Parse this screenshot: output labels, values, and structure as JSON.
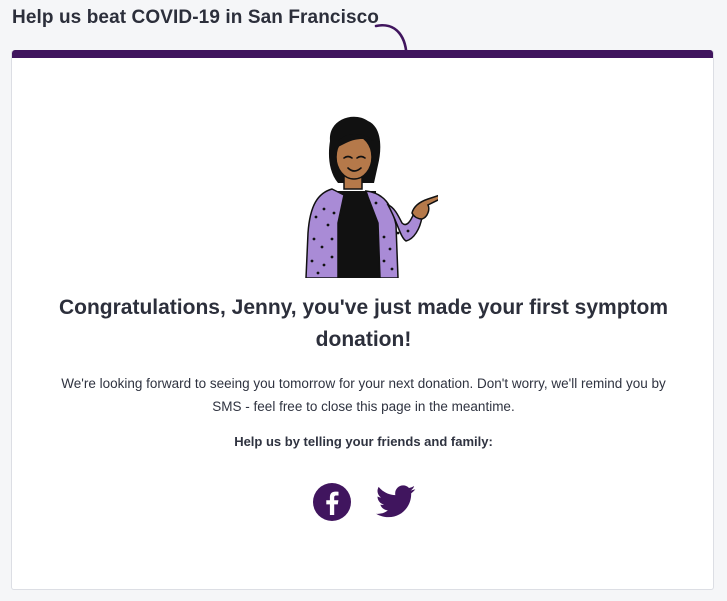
{
  "header": {
    "title": "Help us beat COVID-19 in San Francisco"
  },
  "card": {
    "headline": "Congratulations, Jenny, you've just made your first symptom donation!",
    "body": "We're looking forward to seeing you tomorrow for your next donation. Don't worry, we'll remind you by SMS - feel free to close this page in the meantime.",
    "share_label": "Help us by telling your friends and family:"
  },
  "social": [
    {
      "icon": "facebook-icon"
    },
    {
      "icon": "twitter-icon"
    }
  ],
  "colors": {
    "accent": "#40155e",
    "text": "#2c2f3b",
    "background": "#f5f6f8",
    "card": "#ffffff",
    "jacket": "#a98bd6"
  }
}
